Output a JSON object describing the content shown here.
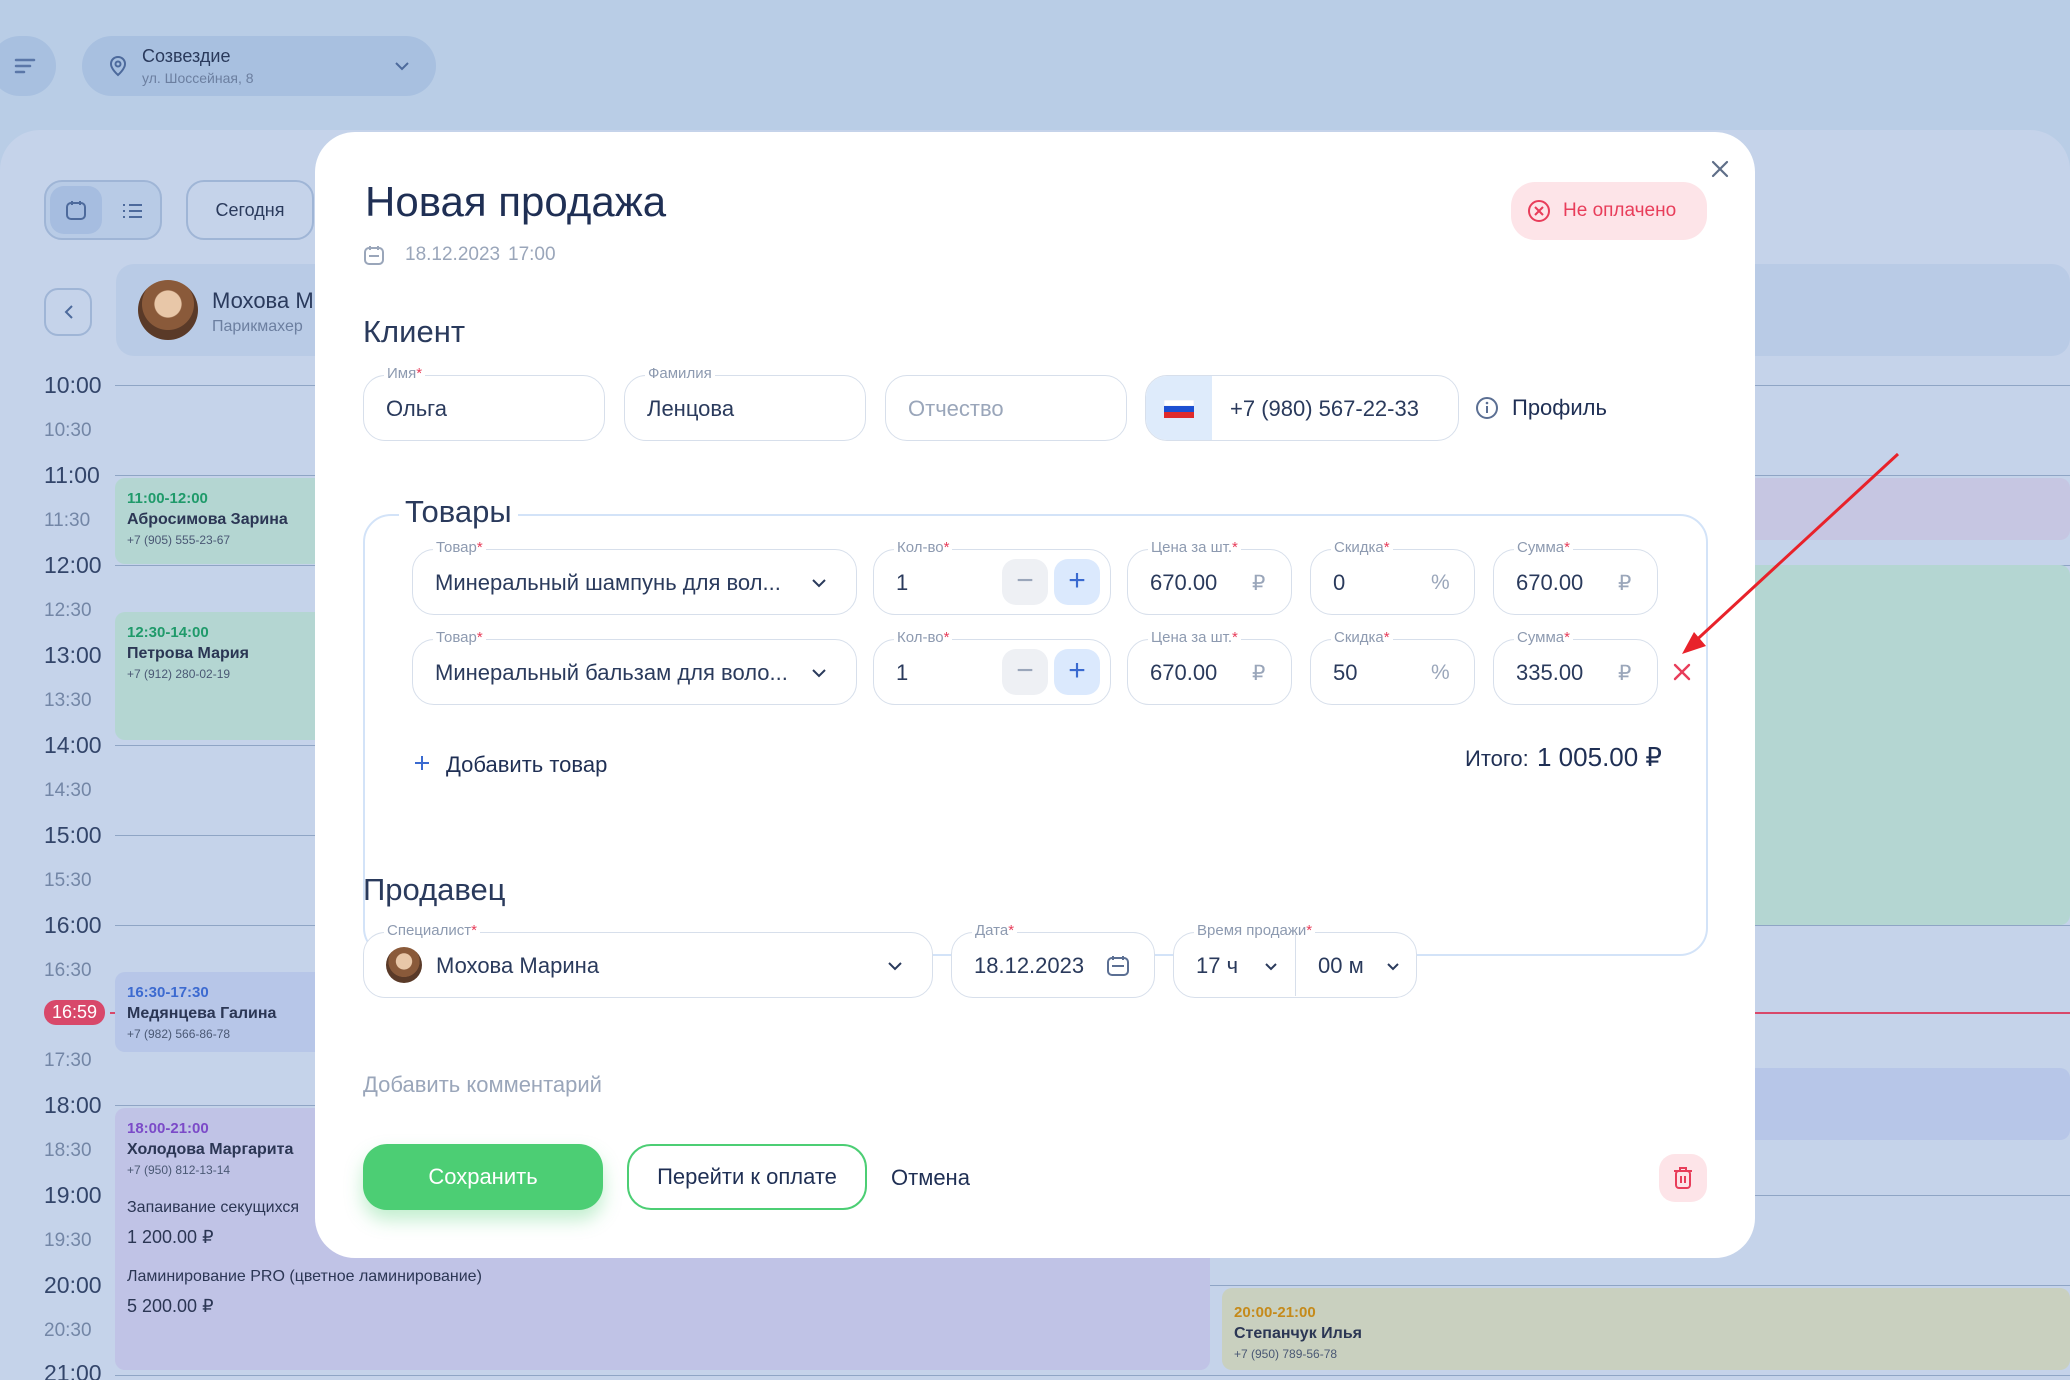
{
  "topbar": {
    "location_name": "Созвездие",
    "location_address": "ул. Шоссейная, 8"
  },
  "calendar": {
    "today_button": "Сегодня",
    "specialist_name": "Мохова М",
    "specialist_role": "Парикмахер",
    "times": [
      "10:00",
      "10:30",
      "11:00",
      "11:30",
      "12:00",
      "12:30",
      "13:00",
      "13:30",
      "14:00",
      "14:30",
      "15:00",
      "15:30",
      "16:00",
      "16:30",
      "16:59",
      "17:30",
      "18:00",
      "18:30",
      "19:00",
      "19:30",
      "20:00",
      "20:30",
      "21:00"
    ],
    "current_time": "16:59",
    "events": [
      {
        "time": "11:00-12:00",
        "name": "Абросимова Зарина",
        "phone": "+7 (905) 555-23-67"
      },
      {
        "time": "12:30-14:00",
        "name": "Петрова Мария",
        "phone": "+7 (912) 280-02-19"
      },
      {
        "time": "16:30-17:30",
        "name": "Медянцева Галина",
        "phone": "+7 (982) 566-86-78"
      },
      {
        "time": "18:00-21:00",
        "name": "Холодова Маргарита",
        "phone": "+7 (950) 812-13-14",
        "service1": "Запаивание секущихся",
        "price1": "1 200.00 ₽",
        "service2": "Ламинирование PRO (цветное ламинирование)",
        "price2": "5 200.00 ₽"
      },
      {
        "time": "20:00-21:00",
        "name": "Степанчук Илья",
        "phone": "+7 (950) 789-56-78"
      }
    ]
  },
  "modal": {
    "title": "Новая продажа",
    "date": "18.12.2023",
    "time": "17:00",
    "status_badge": "Не оплачено",
    "client_section": "Клиент",
    "client": {
      "first_name_label": "Имя",
      "first_name": "Ольга",
      "last_name_label": "Фамилия",
      "last_name": "Ленцова",
      "middle_name_placeholder": "Отчество",
      "phone": "+7 (980) 567-22-33",
      "profile_link": "Профиль"
    },
    "goods_section": "Товары",
    "goods_labels": {
      "product": "Товар",
      "qty": "Кол-во",
      "price": "Цена за шт.",
      "discount": "Скидка",
      "sum": "Сумма"
    },
    "currency": "₽",
    "percent": "%",
    "goods": [
      {
        "product": "Минеральный шампунь для вол...",
        "qty": "1",
        "price": "670.00",
        "discount": "0",
        "sum": "670.00"
      },
      {
        "product": "Минеральный бальзам для воло...",
        "qty": "1",
        "price": "670.00",
        "discount": "50",
        "sum": "335.00"
      }
    ],
    "add_product": "Добавить товар",
    "total_label": "Итого:",
    "total_value": "1 005.00 ₽",
    "seller_section": "Продавец",
    "seller": {
      "specialist_label": "Специалист",
      "specialist": "Мохова Марина",
      "date_label": "Дата",
      "date": "18.12.2023",
      "time_label": "Время продажи",
      "hours": "17 ч",
      "minutes": "00 м"
    },
    "add_comment": "Добавить комментарий",
    "save_button": "Сохранить",
    "pay_button": "Перейти к оплате",
    "cancel_button": "Отмена"
  },
  "colors": {
    "accent_green": "#4cce74",
    "danger": "#e83d5a",
    "primary_blue": "#2a3a5c",
    "annotation_red": "#e8222a"
  }
}
